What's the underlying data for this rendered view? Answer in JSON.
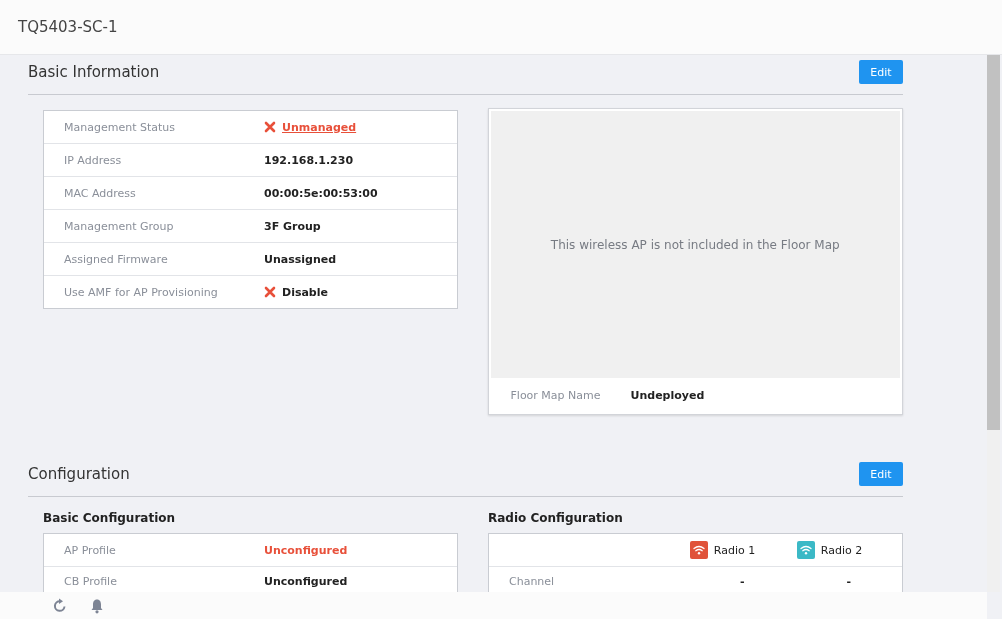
{
  "header": {
    "title": "TQ5403-SC-1"
  },
  "basic_information": {
    "title": "Basic Information",
    "edit_button": "Edit",
    "rows": [
      {
        "label": "Management Status",
        "value": "Unmanaged",
        "kind": "error",
        "link": true,
        "alert": true
      },
      {
        "label": "IP Address",
        "value": "192.168.1.230",
        "kind": "plain",
        "link": false,
        "alert": false
      },
      {
        "label": "MAC Address",
        "value": "00:00:5e:00:53:00",
        "kind": "plain",
        "link": false,
        "alert": false
      },
      {
        "label": "Management Group",
        "value": "3F Group",
        "kind": "plain",
        "link": false,
        "alert": false
      },
      {
        "label": "Assigned Firmware",
        "value": "Unassigned",
        "kind": "plain",
        "link": false,
        "alert": false
      },
      {
        "label": "Use AMF for AP Provisioning",
        "value": "Disable",
        "kind": "error",
        "link": false,
        "alert": false
      }
    ],
    "floor_map": {
      "message": "This wireless AP is not included in the Floor Map",
      "label": "Floor Map Name",
      "value": "Undeployed"
    }
  },
  "configuration": {
    "title": "Configuration",
    "edit_button": "Edit",
    "basic_configuration": {
      "title": "Basic Configuration",
      "rows": [
        {
          "label": "AP Profile",
          "value": "Unconfigured",
          "alert": true
        },
        {
          "label": "CB Profile",
          "value": "Unconfigured",
          "alert": false
        }
      ]
    },
    "radio_configuration": {
      "title": "Radio Configuration",
      "radios": [
        {
          "name": "Radio 1",
          "color": "#e0533a"
        },
        {
          "name": "Radio 2",
          "color": "#3bb9c6"
        }
      ],
      "rows": [
        {
          "label": "Channel",
          "values": [
            "-",
            "-"
          ]
        }
      ]
    }
  },
  "footer_toolbar": {
    "buttons": [
      {
        "kind": "refresh"
      },
      {
        "kind": "bell"
      }
    ]
  }
}
